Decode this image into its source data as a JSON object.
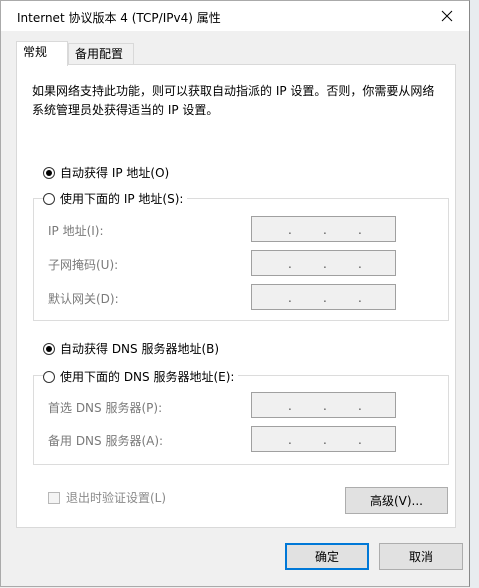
{
  "window": {
    "title": "Internet 协议版本 4 (TCP/IPv4) 属性"
  },
  "tabs": [
    {
      "label": "常规",
      "active": true
    },
    {
      "label": "备用配置",
      "active": false
    }
  ],
  "description": "如果网络支持此功能，则可以获取自动指派的 IP 设置。否则，你需要从网络系统管理员处获得适当的 IP 设置。",
  "ip_section": {
    "auto_label": "自动获得 IP 地址(O)",
    "manual_label": "使用下面的 IP 地址(S):",
    "auto_selected": true,
    "fields": [
      {
        "label": "IP 地址(I):"
      },
      {
        "label": "子网掩码(U):"
      },
      {
        "label": "默认网关(D):"
      }
    ]
  },
  "dns_section": {
    "auto_label": "自动获得 DNS 服务器地址(B)",
    "manual_label": "使用下面的 DNS 服务器地址(E):",
    "auto_selected": true,
    "fields": [
      {
        "label": "首选 DNS 服务器(P):"
      },
      {
        "label": "备用 DNS 服务器(A):"
      }
    ]
  },
  "validate_label": "退出时验证设置(L)",
  "advanced_label": "高级(V)...",
  "ok_label": "确定",
  "cancel_label": "取消",
  "ip_dot": "."
}
